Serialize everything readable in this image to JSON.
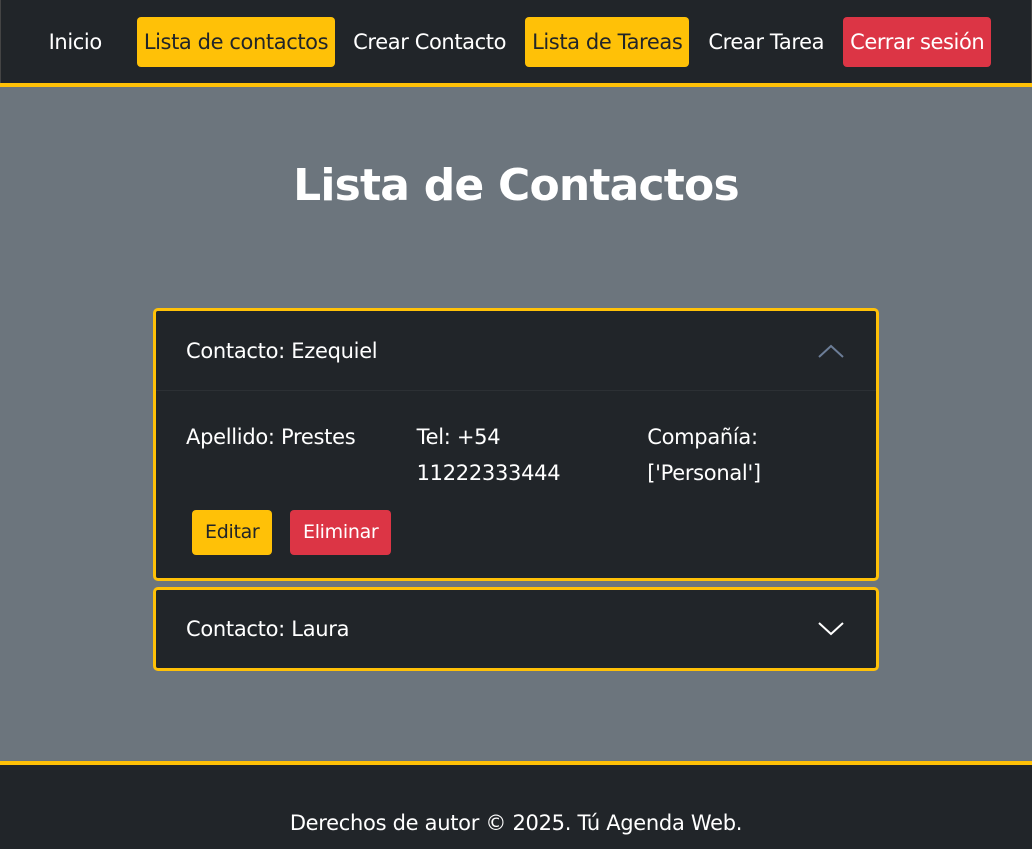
{
  "navbar": {
    "items": [
      {
        "label": "Inicio",
        "style": "plain"
      },
      {
        "label": "Lista de contactos",
        "style": "warning"
      },
      {
        "label": "Crear Contacto",
        "style": "plain"
      },
      {
        "label": "Lista de Tareas",
        "style": "warning"
      },
      {
        "label": "Crear Tarea",
        "style": "plain"
      },
      {
        "label": "Cerrar sesión",
        "style": "danger"
      }
    ]
  },
  "main": {
    "title": "Lista de Contactos",
    "contacts": [
      {
        "header": "Contacto: Ezequiel",
        "expanded": true,
        "chevron_icon": "chevron-up-icon",
        "apellido": "Apellido: Prestes",
        "tel_line1": "Tel: +54",
        "tel_line2": "11222333444",
        "compania_line1": "Compañía:",
        "compania_line2": "['Personal']",
        "edit_label": "Editar",
        "delete_label": "Eliminar"
      },
      {
        "header": "Contacto: Laura",
        "expanded": false,
        "chevron_icon": "chevron-down-icon"
      }
    ]
  },
  "footer": {
    "text": "Derechos de autor © 2025. Tú Agenda Web."
  },
  "colors": {
    "navbar_bg": "#212529",
    "page_bg": "#6c757d",
    "warning": "#ffc107",
    "danger": "#dc3545"
  }
}
